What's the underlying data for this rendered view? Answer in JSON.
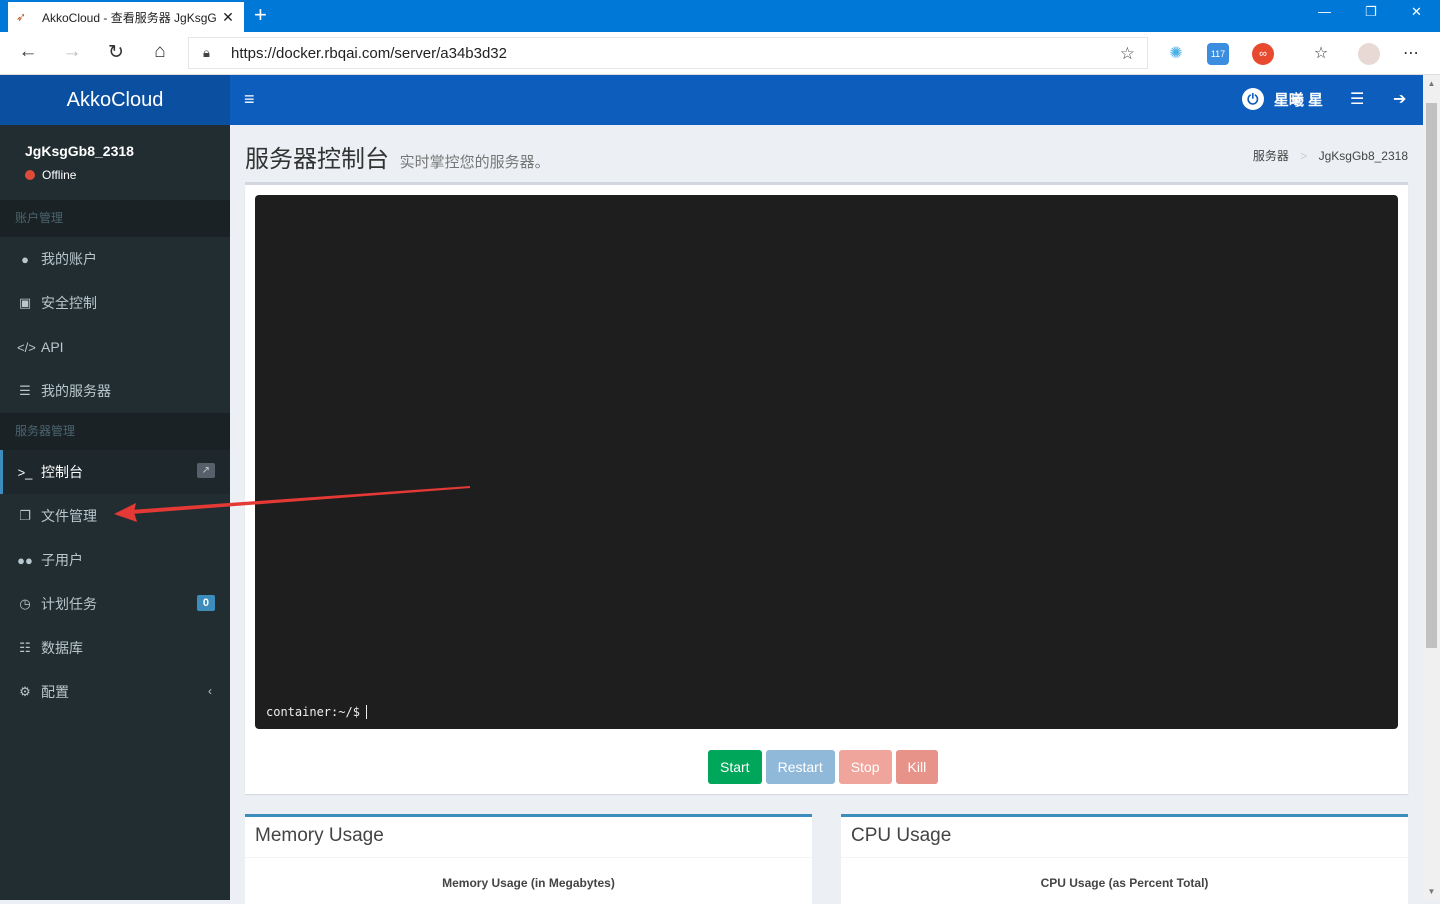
{
  "browser": {
    "tab_title": "AkkoCloud - 查看服务器 JgKsgG",
    "url": "https://docker.rbqai.com/server/a34b3d32",
    "ext_badge": "117"
  },
  "app": {
    "brand": "AkkoCloud",
    "user_name": "星曦 星",
    "colors": {
      "header": "#0d5dbd",
      "sidebar": "#222d32",
      "accent": "#3c8dbc"
    }
  },
  "sidebar": {
    "server_name": "JgKsgGb8_2318",
    "status": "Offline",
    "section_account": "账户管理",
    "section_server": "服务器管理",
    "account_items": [
      {
        "label": "我的账户",
        "icon": "user-icon"
      },
      {
        "label": "安全控制",
        "icon": "lock-icon"
      },
      {
        "label": "API",
        "icon": "code-icon"
      },
      {
        "label": "我的服务器",
        "icon": "server-list-icon"
      }
    ],
    "server_items": [
      {
        "label": "控制台",
        "icon": "terminal-icon"
      },
      {
        "label": "文件管理",
        "icon": "files-icon"
      },
      {
        "label": "子用户",
        "icon": "users-icon"
      },
      {
        "label": "计划任务",
        "icon": "clock-icon",
        "badge": "0"
      },
      {
        "label": "数据库",
        "icon": "database-icon"
      },
      {
        "label": "配置",
        "icon": "gears-icon"
      }
    ]
  },
  "page": {
    "title": "服务器控制台",
    "subtitle": "实时掌控您的服务器。",
    "breadcrumb": [
      "服务器",
      "JgKsgGb8_2318"
    ]
  },
  "console": {
    "prompt": "container:~/$",
    "buttons": {
      "start": "Start",
      "restart": "Restart",
      "stop": "Stop",
      "kill": "Kill"
    }
  },
  "charts": {
    "memory": {
      "header": "Memory Usage",
      "title": "Memory Usage (in Megabytes)"
    },
    "cpu": {
      "header": "CPU Usage",
      "title": "CPU Usage (as Percent Total)"
    }
  }
}
